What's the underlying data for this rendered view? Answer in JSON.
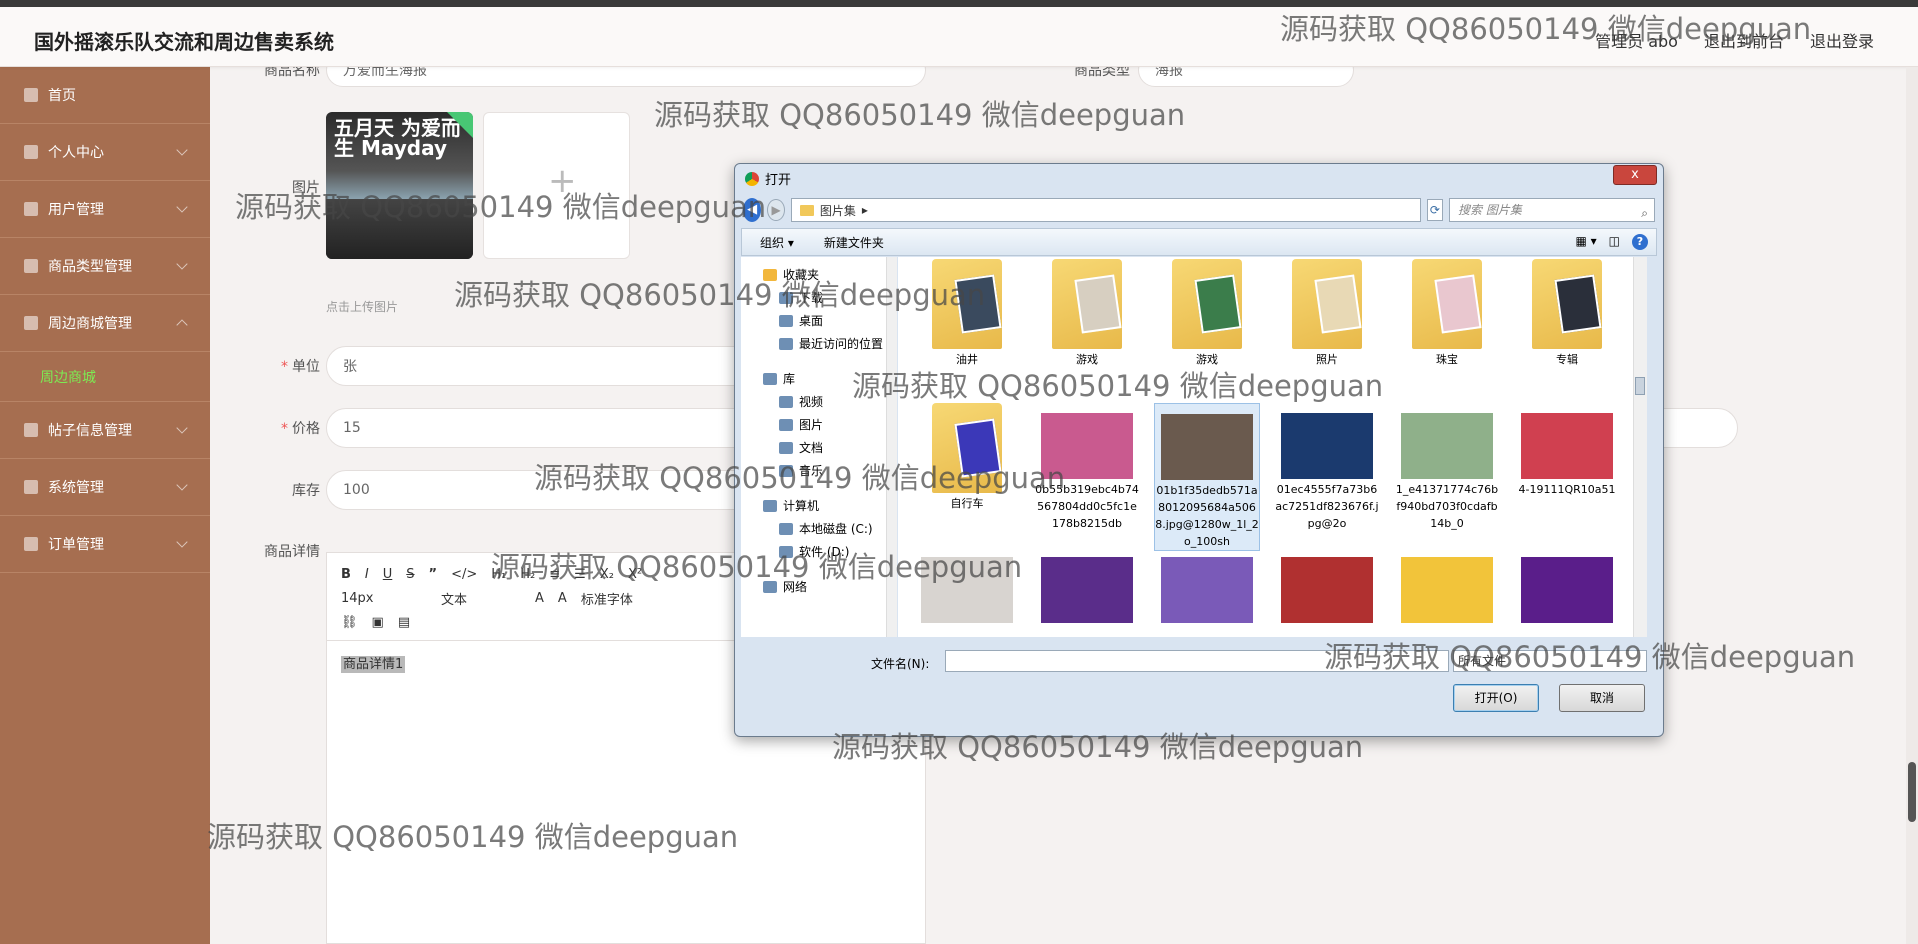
{
  "app": {
    "title": "国外摇滚乐队交流和周边售卖系统",
    "links": [
      "管理员 abo",
      "退出到前台",
      "退出登录"
    ]
  },
  "sidebar": {
    "items": [
      {
        "label": "首页",
        "icon": "home-icon"
      },
      {
        "label": "个人中心",
        "icon": "user-icon"
      },
      {
        "label": "用户管理",
        "icon": "users-icon"
      },
      {
        "label": "商品类型管理",
        "icon": "list-icon"
      },
      {
        "label": "周边商城管理",
        "icon": "shop-icon",
        "expanded": true
      },
      {
        "label": "帖子信息管理",
        "icon": "post-icon"
      },
      {
        "label": "系统管理",
        "icon": "settings-icon"
      },
      {
        "label": "订单管理",
        "icon": "order-icon"
      }
    ],
    "active_sub": "周边商城"
  },
  "form": {
    "product_name_label": "商品名称",
    "product_name_value": "万爱而生海报",
    "product_type_label": "商品类型",
    "product_type_value": "海报",
    "image_label": "图片",
    "upload_hint": "点击上传图片",
    "thumb_text": "五月天 为爱而生 Mayday",
    "unit_label": "单位",
    "unit_value": "张",
    "price_label": "价格",
    "price_value": "15",
    "stock_label": "库存",
    "stock_value": "100",
    "detail_label": "商品详情",
    "editor_font_size": "14px",
    "editor_block": "文本",
    "editor_font": "标准字体",
    "editor_content": "商品详情1"
  },
  "dialog": {
    "title": "打开",
    "close_label": "x",
    "path": "图片集",
    "search_placeholder": "搜索 图片集",
    "organize": "组织 ▾",
    "new_folder": "新建文件夹",
    "tree": [
      {
        "label": "收藏夹",
        "level": 0
      },
      {
        "label": "下载",
        "level": 1
      },
      {
        "label": "桌面",
        "level": 1
      },
      {
        "label": "最近访问的位置",
        "level": 1
      },
      {
        "label": "库",
        "level": 0
      },
      {
        "label": "视频",
        "level": 1
      },
      {
        "label": "图片",
        "level": 1
      },
      {
        "label": "文档",
        "level": 1
      },
      {
        "label": "音乐",
        "level": 1
      },
      {
        "label": "计算机",
        "level": 0
      },
      {
        "label": "本地磁盘 (C:)",
        "level": 1
      },
      {
        "label": "软件 (D:)",
        "level": 1
      },
      {
        "label": "网络",
        "level": 0
      }
    ],
    "files": [
      {
        "name": "油井",
        "kind": "folder",
        "color": "#3a4a5e"
      },
      {
        "name": "游戏",
        "kind": "folder",
        "color": "#d7cfc1"
      },
      {
        "name": "游戏",
        "kind": "folder",
        "color": "#3b7d4b"
      },
      {
        "name": "照片",
        "kind": "folder",
        "color": "#e8d9b5"
      },
      {
        "name": "珠宝",
        "kind": "folder",
        "color": "#e9c7cf"
      },
      {
        "name": "专辑",
        "kind": "folder",
        "color": "#2a2f3a"
      },
      {
        "name": "自行车",
        "kind": "folder",
        "color": "#3b38b8"
      },
      {
        "name": "0b55b319ebc4b74567804dd0c5fc1e178b8215db",
        "kind": "photo",
        "color": "#c95a8f"
      },
      {
        "name": "01b1f35dedb571a8012095684a5068.jpg@1280w_1l_2o_100sh",
        "kind": "photo",
        "color": "#6a5a4e",
        "selected": true
      },
      {
        "name": "01ec4555f7a73b6ac7251df823676f.jpg@2o",
        "kind": "photo",
        "color": "#1b3a6e"
      },
      {
        "name": "1_e41371774c76bf940bd703f0cdafb14b_0",
        "kind": "photo",
        "color": "#8fb08a"
      },
      {
        "name": "4-19111QR10a51",
        "kind": "photo",
        "color": "#d04050"
      },
      {
        "name": "",
        "kind": "photo",
        "color": "#d8d4d0"
      },
      {
        "name": "",
        "kind": "photo",
        "color": "#5a2d8a"
      },
      {
        "name": "",
        "kind": "photo",
        "color": "#7a5ab8"
      },
      {
        "name": "",
        "kind": "photo",
        "color": "#b03030"
      },
      {
        "name": "",
        "kind": "photo",
        "color": "#f2c43a"
      },
      {
        "name": "",
        "kind": "photo",
        "color": "#5a1e8a"
      }
    ],
    "filename_label": "文件名(N):",
    "filetype": "所有文件",
    "open_button": "打开(O)",
    "cancel_button": "取消"
  },
  "watermark": "源码获取 QQ86050149 微信deepguan"
}
